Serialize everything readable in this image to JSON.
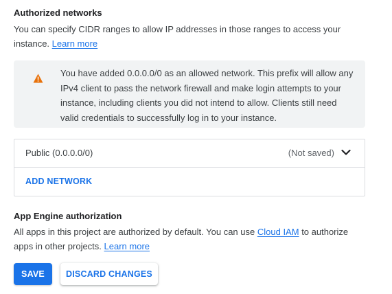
{
  "authorized_networks": {
    "heading": "Authorized networks",
    "description_line1": "You can specify CIDR ranges to allow IP addresses in those ranges to access your",
    "description_line2": "instance.",
    "learn_more": "Learn more"
  },
  "warning": {
    "icon": "warning-triangle-icon",
    "icon_color": "#e8710a",
    "line1": "You have added 0.0.0.0/0 as an allowed network. This prefix will allow any",
    "line2": "IPv4 client to pass the network firewall and make login attempts to your",
    "line3": "instance, including clients you did not intend to allow. Clients still need",
    "line4": "valid credentials to successfully log in to your instance."
  },
  "networks": {
    "items": [
      {
        "name": "Public (0.0.0.0/0)",
        "status": "(Not saved)"
      }
    ],
    "add_label": "ADD NETWORK"
  },
  "app_engine": {
    "heading": "App Engine authorization",
    "line1_prefix": "All apps in this project are authorized by default. You can use",
    "cloud_iam": "Cloud IAM",
    "line1_suffix": "to authorize",
    "line2": "apps in other projects.",
    "learn_more": "Learn more"
  },
  "actions": {
    "save_label": "SAVE",
    "discard_label": "DISCARD CHANGES"
  },
  "colors": {
    "accent": "#1a73e8",
    "warning_bg": "#f1f3f4"
  }
}
